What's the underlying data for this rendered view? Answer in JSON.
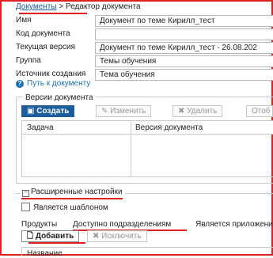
{
  "breadcrumb": {
    "root": "Документы",
    "separator": ">",
    "current": "Редактор документа"
  },
  "fields": [
    {
      "label": "Имя",
      "value": "Документ по теме Кирилл_тест"
    },
    {
      "label": "Код документа",
      "value": ""
    },
    {
      "label": "Текущая версия",
      "value": "Документ по теме Кирилл_тест  - 26.08.202"
    },
    {
      "label": "Группа",
      "value": "Темы обучения"
    },
    {
      "label": "Источник создания",
      "value": "Тема обучения"
    }
  ],
  "path_link": "Путь к документу",
  "versions": {
    "title": "Версии документа",
    "buttons": {
      "create": "Создать",
      "edit": "Изменить",
      "delete": "Удалить",
      "more": "Отоб"
    },
    "columns": [
      "Задача",
      "Версия документа"
    ]
  },
  "advanced": {
    "title": "Расширенные настройки",
    "is_template_label": "Является шаблоном",
    "tabs": [
      "Продукты",
      "Доступно подразделениям",
      "Является приложени"
    ],
    "active_tab_index": 1,
    "buttons": {
      "add": "Добавить",
      "exclude": "Исключить"
    },
    "name_column": "Название"
  },
  "colors": {
    "accent": "#1c5d9e",
    "link": "#1a5aa6",
    "highlight": "#e02020"
  },
  "icons": [
    "question-icon",
    "plus-icon",
    "pencil-icon",
    "x-icon",
    "document-icon",
    "minus-box-icon",
    "checkbox-icon"
  ]
}
